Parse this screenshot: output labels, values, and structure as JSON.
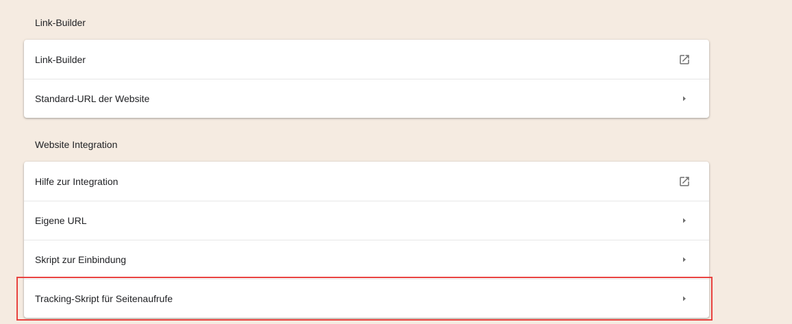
{
  "sections": [
    {
      "title": "Link-Builder",
      "items": [
        {
          "label": "Link-Builder",
          "icon": "external-link-icon"
        },
        {
          "label": "Standard-URL der Website",
          "icon": "arrow-right-icon"
        }
      ]
    },
    {
      "title": "Website Integration",
      "items": [
        {
          "label": "Hilfe zur Integration",
          "icon": "external-link-icon"
        },
        {
          "label": "Eigene URL",
          "icon": "arrow-right-icon"
        },
        {
          "label": "Skript zur Einbindung",
          "icon": "arrow-right-icon"
        },
        {
          "label": "Tracking-Skript für Seitenaufrufe",
          "icon": "arrow-right-icon"
        }
      ]
    }
  ],
  "highlight_color": "#e8423f",
  "background_color": "#f5ebe1"
}
